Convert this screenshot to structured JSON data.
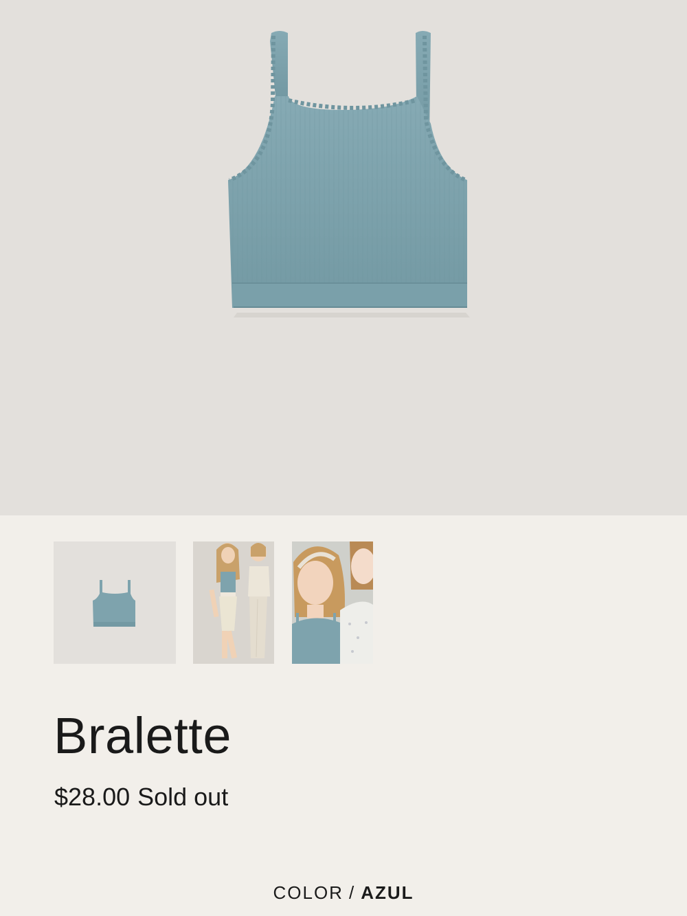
{
  "product": {
    "title": "Bralette",
    "price": "$28.00",
    "availability": "Sold out"
  },
  "color_selector": {
    "label": "COLOR",
    "separator": "/",
    "selected": "AZUL"
  },
  "gallery": {
    "thumbnails": [
      {
        "name": "product-flat-lay"
      },
      {
        "name": "models-walking"
      },
      {
        "name": "models-closeup"
      }
    ]
  },
  "colors": {
    "page_background": "#f2efea",
    "image_background": "#e3e0dc",
    "garment": "#7ea3ad"
  }
}
